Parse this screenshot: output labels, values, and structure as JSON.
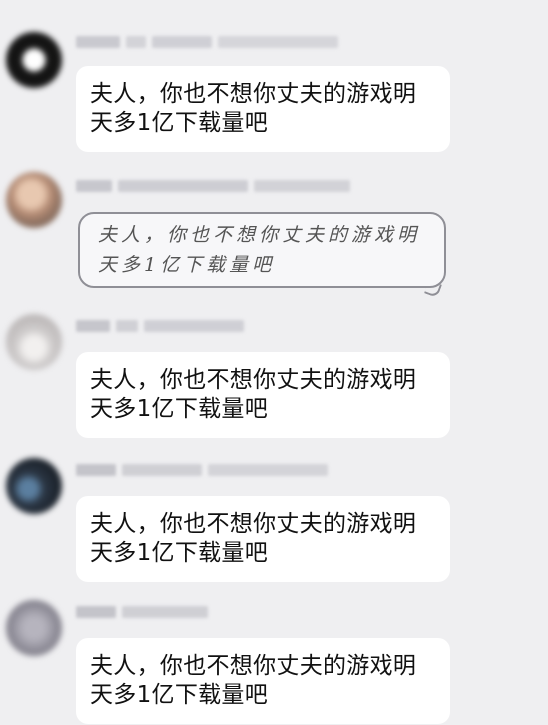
{
  "messages": [
    {
      "text": "夫人，你也不想你丈夫的游戏明天多1亿下载量吧",
      "style": "typed",
      "avatar_color": "#1a1a1a",
      "name_hidden": true
    },
    {
      "text": "夫人，你也不想你丈夫的游戏明天多1亿下载量吧",
      "style": "handwritten",
      "avatar_color": "#c9a088",
      "name_hidden": true
    },
    {
      "text": "夫人，你也不想你丈夫的游戏明天多1亿下载量吧",
      "style": "typed",
      "avatar_color": "#d8d6d6",
      "name_hidden": true
    },
    {
      "text": "夫人，你也不想你丈夫的游戏明天多1亿下载量吧",
      "style": "typed",
      "avatar_color": "#2a3440",
      "name_hidden": true
    },
    {
      "text": "夫人，你也不想你丈夫的游戏明天多1亿下载量吧",
      "style": "typed",
      "avatar_color": "#9a98a4",
      "name_hidden": true
    }
  ]
}
